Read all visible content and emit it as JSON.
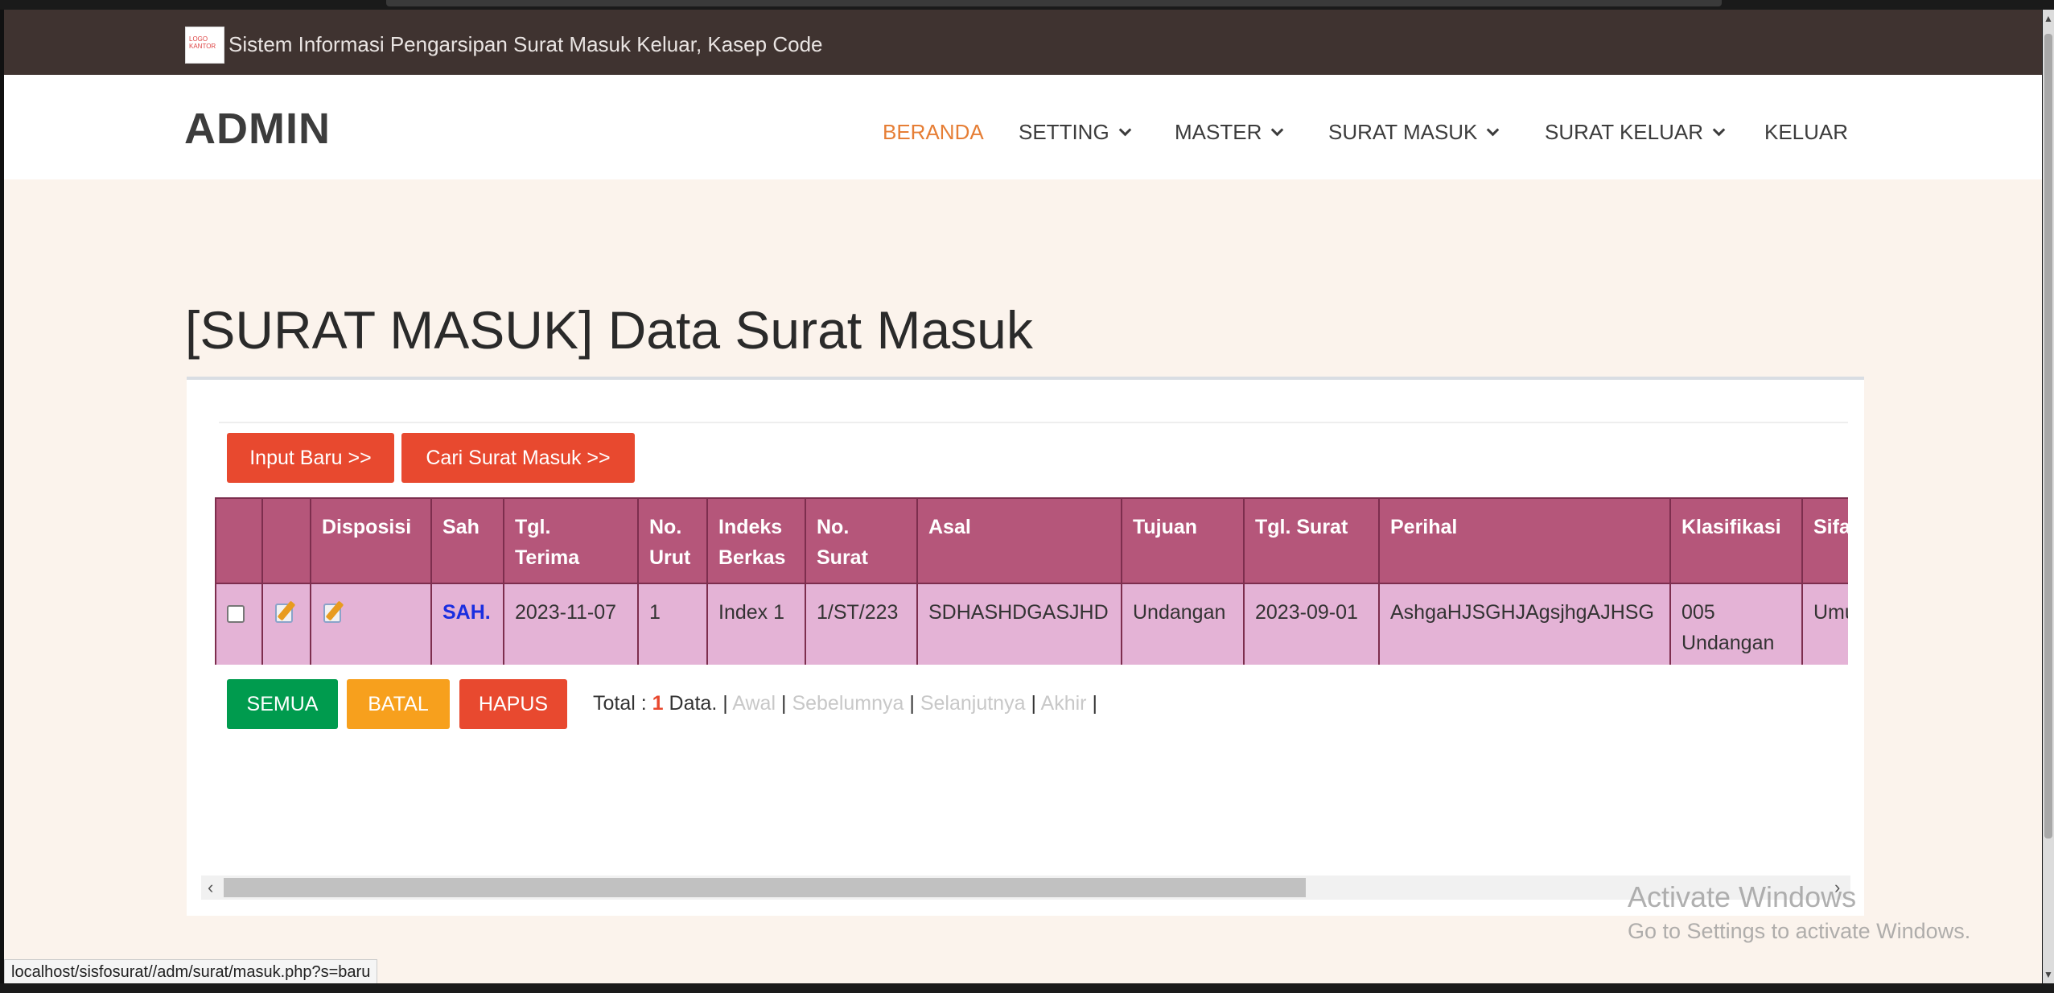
{
  "infobar": {
    "logo_text": "LOGO\nKANTOR",
    "title": "Sistem Informasi Pengarsipan Surat Masuk Keluar, Kasep Code"
  },
  "navbar": {
    "brand": "ADMIN",
    "items": [
      {
        "label": "BERANDA",
        "active": true,
        "dropdown": false
      },
      {
        "label": "SETTING",
        "active": false,
        "dropdown": true
      },
      {
        "label": "MASTER",
        "active": false,
        "dropdown": true
      },
      {
        "label": "SURAT MASUK",
        "active": false,
        "dropdown": true
      },
      {
        "label": "SURAT KELUAR",
        "active": false,
        "dropdown": true
      },
      {
        "label": "KELUAR",
        "active": false,
        "dropdown": false
      }
    ]
  },
  "page": {
    "heading": "[SURAT MASUK] Data Surat Masuk"
  },
  "actions": {
    "input_baru": "Input Baru >>",
    "cari": "Cari Surat Masuk >>"
  },
  "table": {
    "headers": [
      "",
      "",
      "Disposisi",
      "Sah",
      "Tgl.\nTerima",
      "No.\nUrut",
      "Indeks\nBerkas",
      "No.\nSurat",
      "Asal",
      "Tujuan",
      "Tgl. Surat",
      "Perihal",
      "Klasifikasi",
      "Sifat"
    ],
    "headers_visible": [
      "",
      "",
      "Disposisi",
      "Sah",
      "Tgl. Terima",
      "No. Urut",
      "Indeks Berkas",
      "No. Surat",
      "Asal",
      "Tujuan",
      "Tgl. Surat",
      "Perihal",
      "Klasifikasi",
      "Sifa"
    ],
    "rows": [
      {
        "sah": "SAH.",
        "tgl_terima": "2023-11-07",
        "no_urut": "1",
        "indeks_berkas": "Index 1",
        "no_surat": "1/ST/223",
        "asal": "SDHASHDGASJHD",
        "tujuan": "Undangan",
        "tgl_surat": "2023-09-01",
        "perihal": "AshgaHJSGHJAgsjhgAJHSG",
        "klasifikasi_1": "005",
        "klasifikasi_2": "Undangan",
        "sifat": "Umu"
      }
    ]
  },
  "footer": {
    "semua": "SEMUA",
    "batal": "BATAL",
    "hapus": "HAPUS",
    "total_prefix": "Total : ",
    "total_count": "1",
    "total_suffix": " Data. |",
    "awal": "Awal",
    "sebelumnya": "Sebelumnya",
    "selanjutnya": "Selanjutnya",
    "akhir": "Akhir",
    "sep": "|"
  },
  "watermark": {
    "line1": "Activate Windows",
    "line2": "Go to Settings to activate Windows."
  },
  "status_url": "localhost/sisfosurat//adm/surat/masuk.php?s=baru",
  "colors": {
    "accent_orange": "#e67e35",
    "button_red": "#e8492f",
    "button_green": "#009b4e",
    "button_orange": "#f7a01d",
    "table_header": "#b5567a",
    "table_row": "#e4b3d6",
    "sah_blue": "#1a2ee0"
  },
  "icons": [
    "edit-icon",
    "chevron-down-icon",
    "checkbox",
    "scroll-left-icon",
    "scroll-right-icon"
  ]
}
